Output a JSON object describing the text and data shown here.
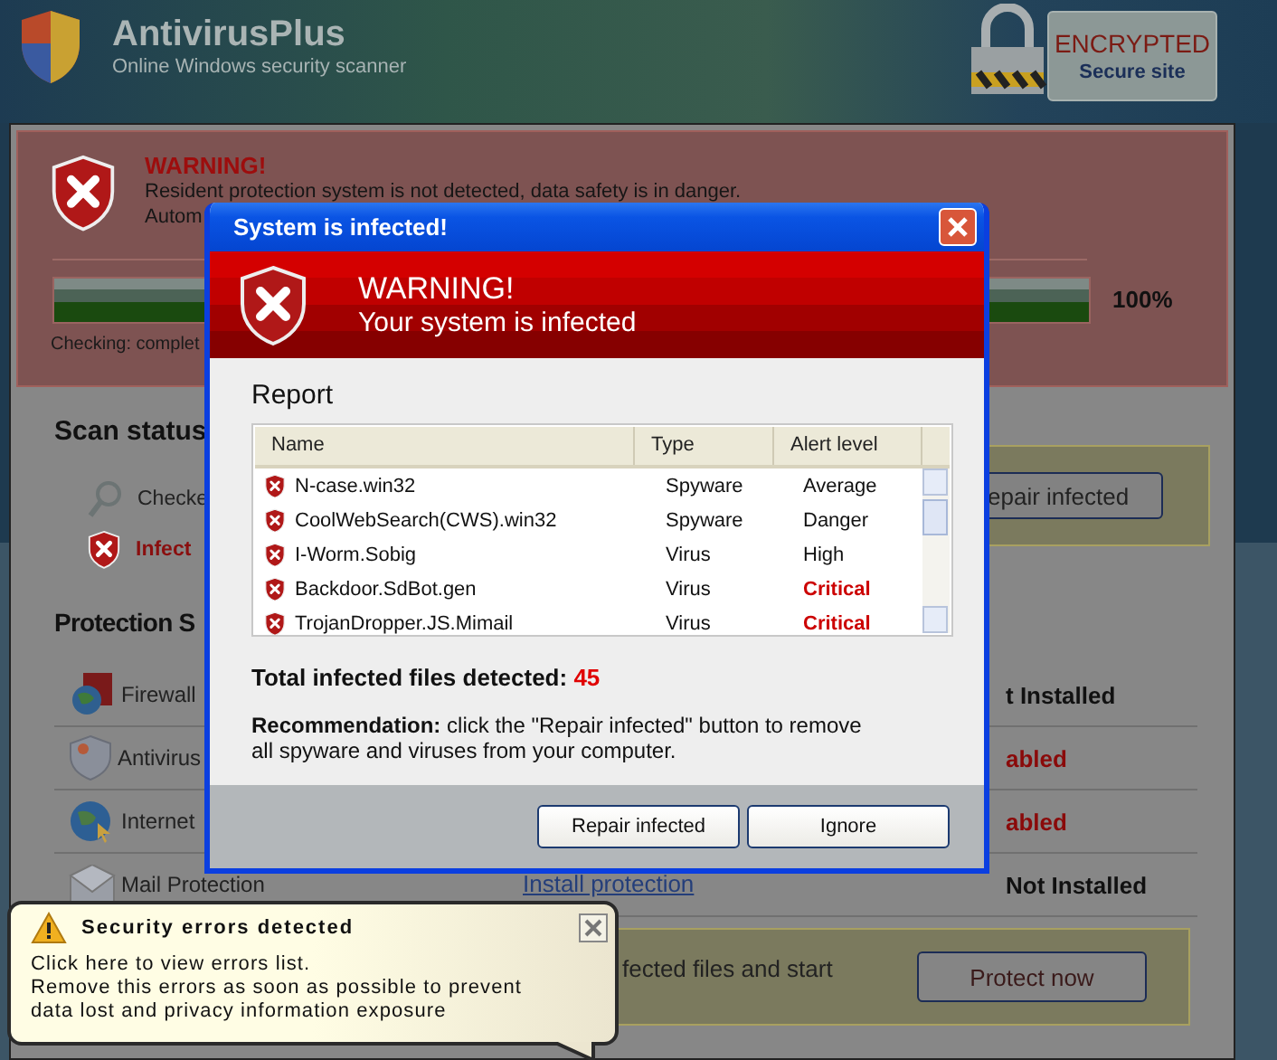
{
  "app": {
    "title": "AntivirusPlus",
    "subtitle": "Online Windows security scanner",
    "badge": {
      "title": "ENCRYPTED",
      "subtitle": "Secure site"
    }
  },
  "warning_panel": {
    "title": "WARNING!",
    "lines": [
      "Resident protection system is not detected, data safety is in danger.",
      "Autom"
    ],
    "progress": {
      "level": 1,
      "reading": "100%"
    },
    "status": "Checking: complet"
  },
  "scan_status": {
    "heading": "Scan status",
    "items": [
      {
        "kind": "checked",
        "label": "Checke"
      },
      {
        "kind": "infected",
        "label": "Infect"
      }
    ],
    "button": "epair infected"
  },
  "protection": {
    "heading": "Protection S",
    "rows": [
      {
        "kind": "firewall",
        "label": "Firewall",
        "status": "t Installed",
        "alert": false
      },
      {
        "kind": "antivirus",
        "label": "Antivirus",
        "status": "abled",
        "alert": true
      },
      {
        "kind": "internet",
        "label": "Internet",
        "status": "abled",
        "alert": true
      },
      {
        "kind": "mail",
        "label": "Mail Protection",
        "link": "Install protection",
        "status": "Not Installed",
        "alert": false
      }
    ]
  },
  "footer_box": {
    "text": "fected files and start",
    "button": "Protect now"
  },
  "dialog": {
    "title": "System is infected!",
    "header_title": "WARNING!",
    "header_subtitle": "Your system is infected",
    "report": {
      "heading": "Report",
      "columns": [
        "Name",
        "Type",
        "Alert level"
      ],
      "rows": [
        {
          "name": "N-case.win32",
          "type": "Spyware",
          "alert": "Average",
          "critical": false
        },
        {
          "name": "CoolWebSearch(CWS).win32",
          "type": "Spyware",
          "alert": "Danger",
          "critical": false
        },
        {
          "name": "I-Worm.Sobig",
          "type": "Virus",
          "alert": "High",
          "critical": false
        },
        {
          "name": "Backdoor.SdBot.gen",
          "type": "Virus",
          "alert": "Critical",
          "critical": true
        },
        {
          "name": "TrojanDropper.JS.Mimail",
          "type": "Virus",
          "alert": "Critical",
          "critical": true
        }
      ]
    },
    "total_label": "Total infected files detected:",
    "total_value": "45",
    "recommendation": "**Recommendation:** click the \"Repair infected\" button to remove all spyware and viruses from your computer.",
    "buttons": [
      "Repair infected",
      "Ignore"
    ]
  },
  "balloon": {
    "title": "Security errors detected",
    "lines": [
      "Click here to view errors list.",
      "Remove this errors as soon as possible to prevent",
      "data lost and privacy information exposure"
    ]
  }
}
